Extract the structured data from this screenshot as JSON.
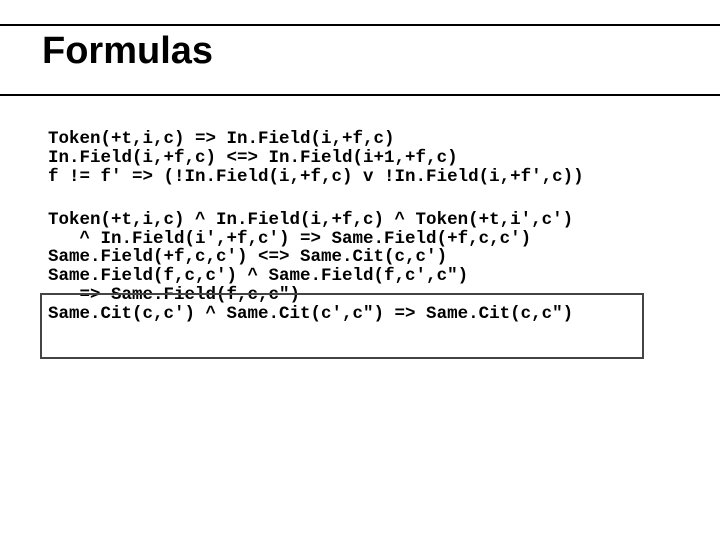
{
  "slide": {
    "title": "Formulas",
    "block1": {
      "line1": "Token(+t,i,c) => In.Field(i,+f,c)",
      "line2": "In.Field(i,+f,c) <=> In.Field(i+1,+f,c)",
      "line3": "f != f' => (!In.Field(i,+f,c) v !In.Field(i,+f',c))"
    },
    "block2": {
      "line1": "Token(+t,i,c) ^ In.Field(i,+f,c) ^ Token(+t,i',c')",
      "line2": "   ^ In.Field(i',+f,c') => Same.Field(+f,c,c')",
      "line3": "Same.Field(+f,c,c') <=> Same.Cit(c,c')",
      "line4": "Same.Field(f,c,c') ^ Same.Field(f,c',c\")",
      "line5": "   => Same.Field(f,c,c\")",
      "line6": "Same.Cit(c,c') ^ Same.Cit(c',c\") => Same.Cit(c,c\")"
    }
  }
}
